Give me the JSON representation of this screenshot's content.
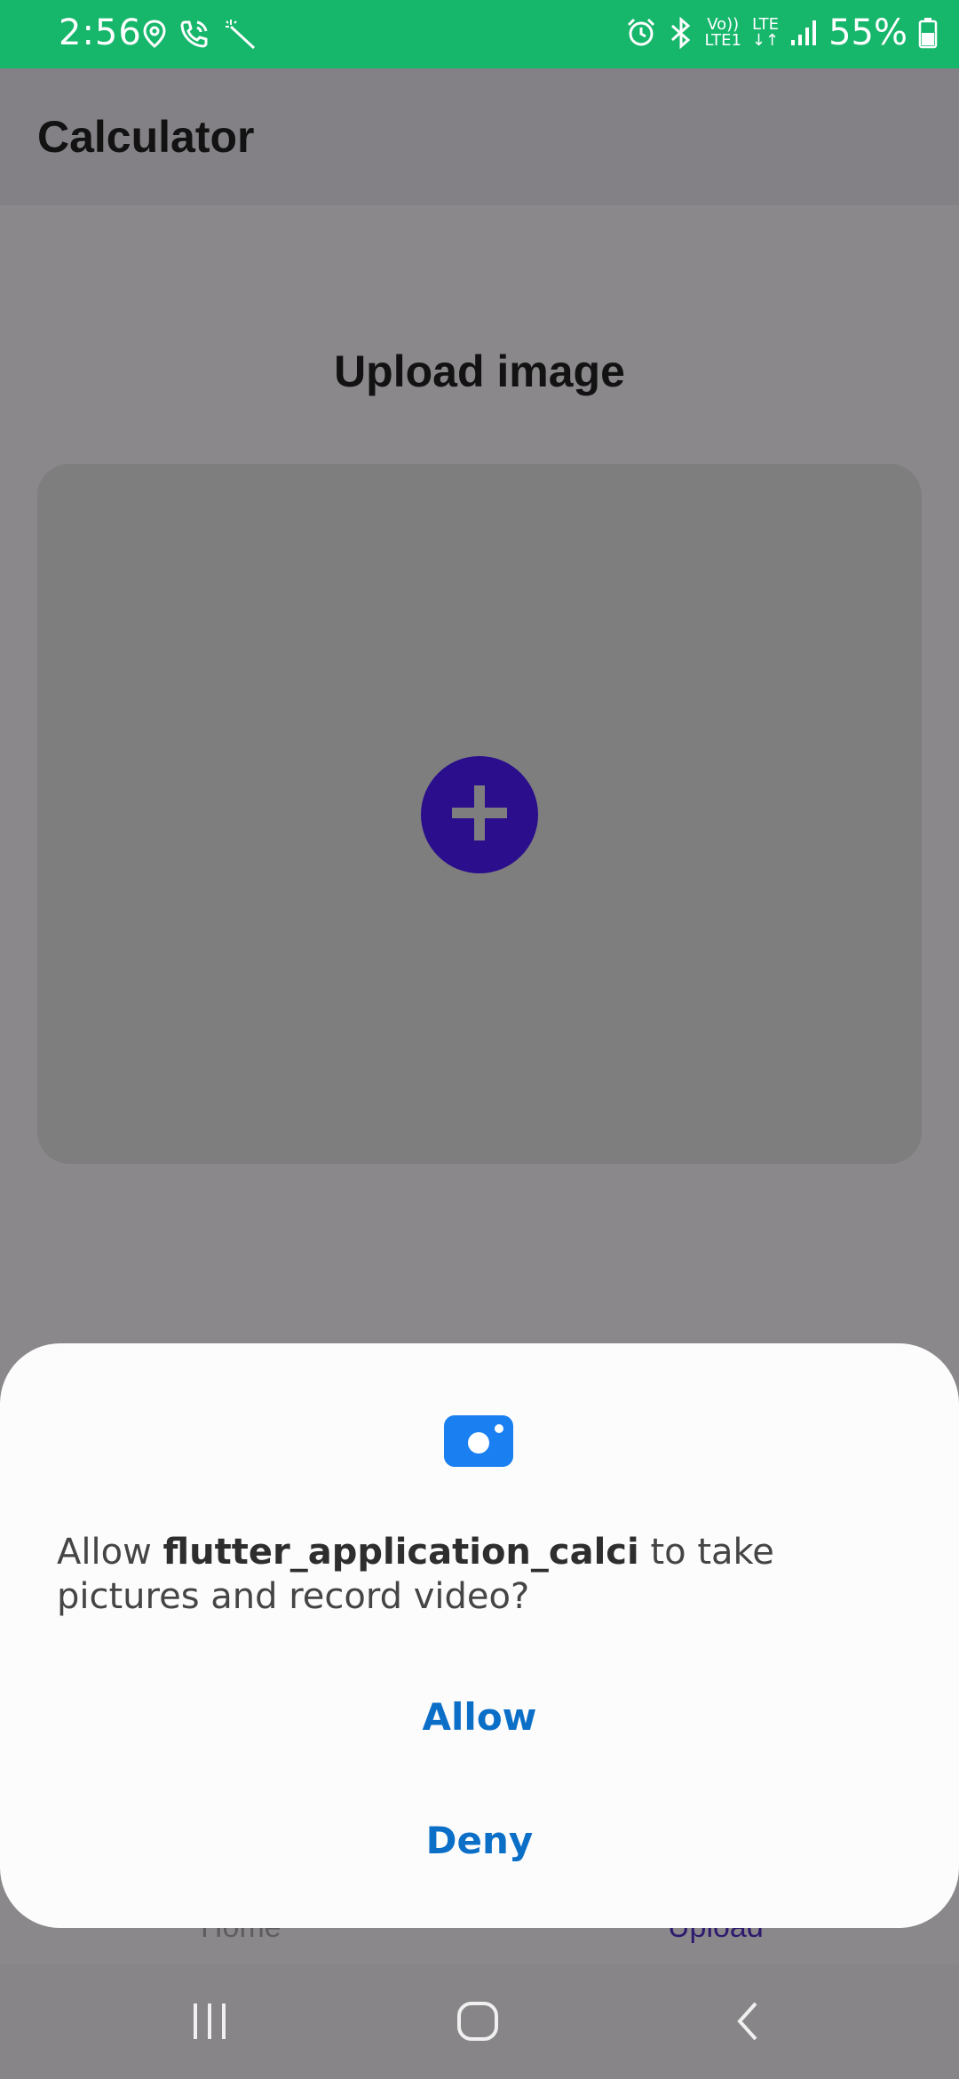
{
  "status_bar": {
    "time": "2:56",
    "network_volte": "Vo))",
    "network_lte1": "LTE1",
    "network_lte": "LTE",
    "battery": "55%",
    "icons": [
      "location-icon",
      "wifi-calling-icon",
      "magic-wand-icon",
      "alarm-icon",
      "bluetooth-icon",
      "signal-icon",
      "battery-icon"
    ]
  },
  "app_bar": {
    "title": "Calculator"
  },
  "main": {
    "section_title": "Upload image",
    "add_icon": "plus-icon"
  },
  "bottom_nav": {
    "home_label": "Home",
    "upload_label": "Upload"
  },
  "dialog": {
    "icon": "camera-icon",
    "message_prefix": "Allow ",
    "app_name": "flutter_application_calci",
    "message_suffix": " to take pictures and record video?",
    "allow_label": "Allow",
    "deny_label": "Deny"
  },
  "system_nav": {
    "buttons": [
      "recent-apps-icon",
      "home-icon",
      "back-icon"
    ]
  },
  "colors": {
    "status_bar": "#16b66b",
    "accent_button": "#2a0e8c",
    "dialog_action": "#0b6fc8",
    "camera_icon": "#1a7ff0"
  }
}
